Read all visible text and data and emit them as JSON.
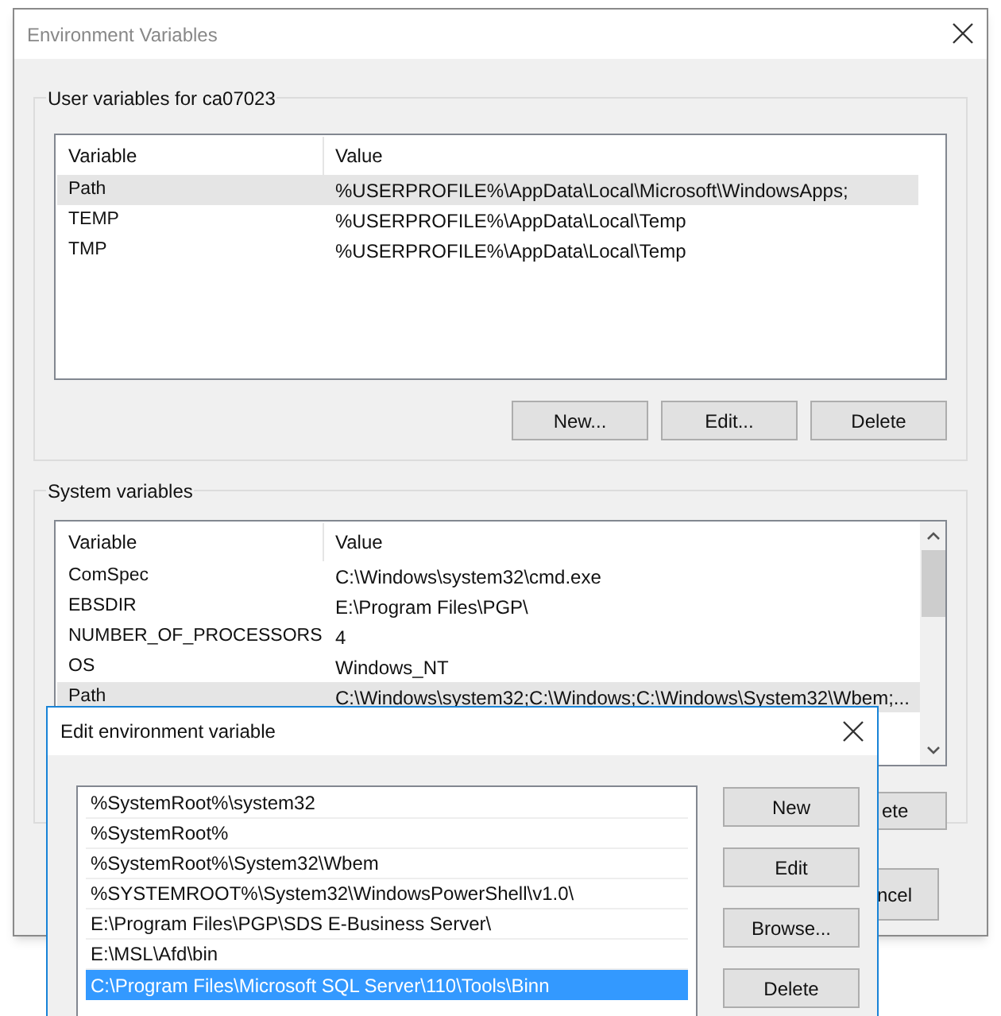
{
  "main_window": {
    "title": "Environment Variables"
  },
  "user_variables": {
    "label": "User variables for ca07023",
    "columns": [
      "Variable",
      "Value"
    ],
    "rows": [
      {
        "variable": "Path",
        "value": "%USERPROFILE%\\AppData\\Local\\Microsoft\\WindowsApps;",
        "selected": true
      },
      {
        "variable": "TEMP",
        "value": "%USERPROFILE%\\AppData\\Local\\Temp",
        "selected": false
      },
      {
        "variable": "TMP",
        "value": "%USERPROFILE%\\AppData\\Local\\Temp",
        "selected": false
      }
    ],
    "buttons": [
      "New...",
      "Edit...",
      "Delete"
    ]
  },
  "system_variables": {
    "label": "System variables",
    "columns": [
      "Variable",
      "Value"
    ],
    "rows": [
      {
        "variable": "ComSpec",
        "value": "C:\\Windows\\system32\\cmd.exe",
        "selected": false
      },
      {
        "variable": "EBSDIR",
        "value": "E:\\Program Files\\PGP\\",
        "selected": false
      },
      {
        "variable": "NUMBER_OF_PROCESSORS",
        "value": "4",
        "selected": false
      },
      {
        "variable": "OS",
        "value": "Windows_NT",
        "selected": false
      },
      {
        "variable": "Path",
        "value": "C:\\Windows\\system32;C:\\Windows;C:\\Windows\\System32\\Wbem;...",
        "selected": true
      }
    ],
    "button_partial": "ete"
  },
  "cancel_button_partial": "ncel",
  "edit_dialog": {
    "title": "Edit environment variable",
    "entries": [
      {
        "text": "%SystemRoot%\\system32",
        "selected": false
      },
      {
        "text": "%SystemRoot%",
        "selected": false
      },
      {
        "text": "%SystemRoot%\\System32\\Wbem",
        "selected": false
      },
      {
        "text": "%SYSTEMROOT%\\System32\\WindowsPowerShell\\v1.0\\",
        "selected": false
      },
      {
        "text": "E:\\Program Files\\PGP\\SDS E-Business Server\\",
        "selected": false
      },
      {
        "text": "E:\\MSL\\Afd\\bin",
        "selected": false
      },
      {
        "text": "C:\\Program Files\\Microsoft SQL Server\\110\\Tools\\Binn",
        "selected": true
      }
    ],
    "buttons": [
      "New",
      "Edit",
      "Browse...",
      "Delete"
    ]
  }
}
